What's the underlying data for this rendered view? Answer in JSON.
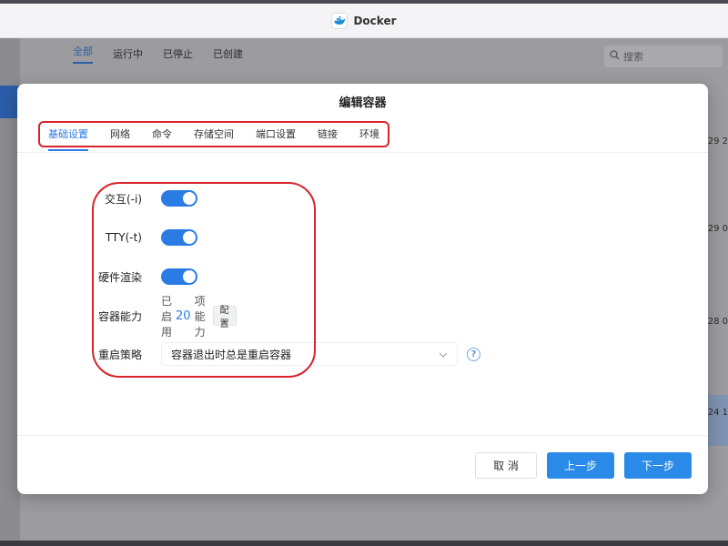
{
  "window": {
    "title": "Docker"
  },
  "background": {
    "tabs": [
      "全部",
      "运行中",
      "已停止",
      "已创建"
    ],
    "search_placeholder": "搜索",
    "dates": [
      "-29 2",
      "29 0",
      "28 0",
      "24 1"
    ]
  },
  "dialog": {
    "title": "编辑容器",
    "tabs": [
      "基础设置",
      "网络",
      "命令",
      "存储空间",
      "端口设置",
      "链接",
      "环境"
    ],
    "fields": {
      "interactive_label": "交互(-i)",
      "tty_label": "TTY(-t)",
      "hw_render_label": "硬件渲染",
      "capabilities_label": "容器能力",
      "capabilities_prefix": "已启用",
      "capabilities_count": "20",
      "capabilities_suffix": "项能力",
      "config_button": "配置",
      "restart_label": "重启策略",
      "restart_value": "容器退出时总是重启容器"
    },
    "toggles": {
      "interactive": true,
      "tty": true,
      "hw_render": true
    },
    "buttons": {
      "cancel": "取 消",
      "prev": "上一步",
      "next": "下一步"
    }
  },
  "colors": {
    "accent": "#2a7be4",
    "annotation": "#d8232a"
  },
  "icons": {
    "search": "search-icon",
    "help": "help-icon",
    "chevron": "chevron-down-icon",
    "logo": "docker-logo-icon"
  }
}
